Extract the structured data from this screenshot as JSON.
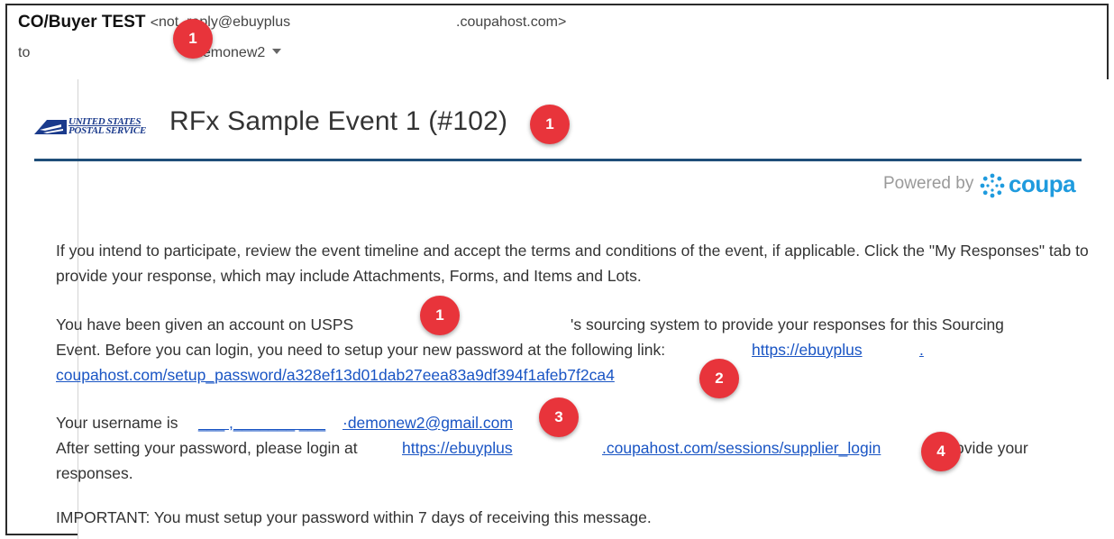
{
  "header": {
    "sender_name": "CO/Buyer TEST",
    "sender_email_prefix": "<",
    "sender_email_local": "not_reply@ebuyplus",
    "sender_email_domain": ".coupahost.com>",
    "to_label": "to",
    "recipient": "demonew2"
  },
  "email": {
    "logo_line1": "UNITED STATES",
    "logo_line2": "POSTAL SERVICE",
    "title": "RFx Sample Event 1 (#102)",
    "powered_by": "Powered by",
    "coupa_word": "coupa",
    "paragraph1": "If you intend to participate, review the event timeline and accept the terms and conditions of the event, if applicable. Click the \"My Responses\" tab to provide your response, which may include Attachments, Forms, and Items and Lots.",
    "paragraph2_part1": "You have been given an account on USPS",
    "paragraph2_part2": "'s sourcing system to provide your responses for this Sourcing",
    "paragraph2_line2": "Event. Before you can login, you need to setup your new password at the following link:",
    "setup_link_part1": "https://ebuyplus",
    "setup_link_part2": ".",
    "setup_link_line2": "coupahost.com/setup_password/a328ef13d01dab27eea83a9df394f1afeb7f2ca4",
    "username_label": "Your username is",
    "username_blank": "___ ,_______ ___",
    "username_value": "·demonew2@gmail.com",
    "login_text": "After setting your password, please login at",
    "login_link_part1": "https://ebuyplus",
    "login_link_part2": ".coupahost.com/sessions/supplier_login",
    "login_suffix": "ovide your",
    "login_line2": "responses.",
    "important": "IMPORTANT: You must setup your password within 7 days of receiving this message."
  },
  "annotations": {
    "badge1": "1",
    "badge2": "1",
    "badge3": "1",
    "badge4": "2",
    "badge5": "3",
    "badge6": "4"
  },
  "colors": {
    "badge": "#e8343b",
    "link": "#1a55c4",
    "rule": "#1f4e79",
    "coupa_blue": "#1f9bde"
  }
}
